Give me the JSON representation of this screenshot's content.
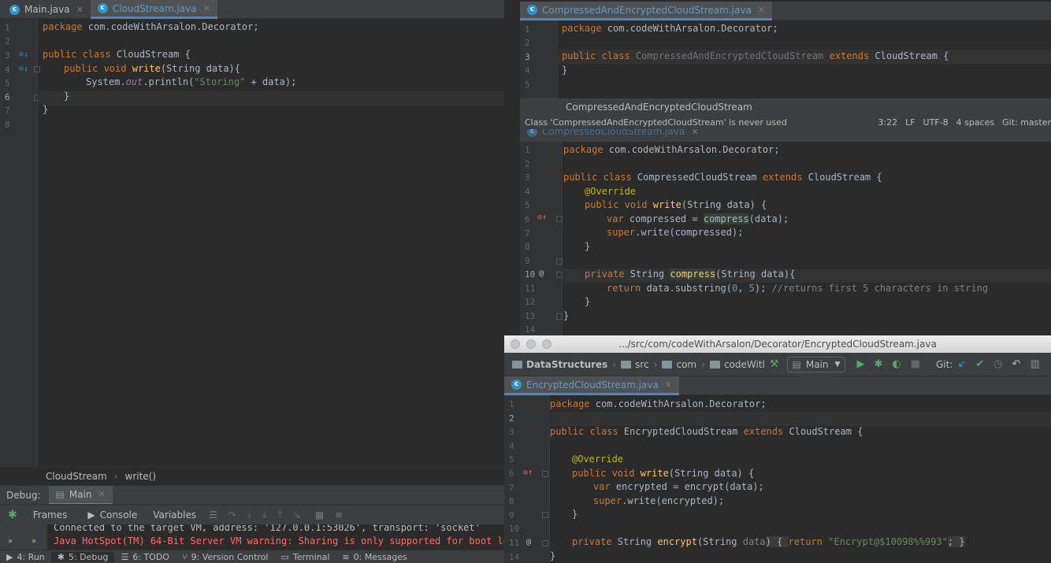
{
  "left_editor": {
    "tabs": [
      {
        "label": "Main.java",
        "icon": "c"
      },
      {
        "label": "CloudStream.java",
        "icon": "c"
      }
    ],
    "line_numbers": [
      "1",
      "2",
      "3",
      "4",
      "5",
      "6",
      "7",
      "8"
    ],
    "lines": [
      {
        "t1": "package",
        "t2": " com.codeWithArsalon.Decorator;"
      },
      {
        "t1": "public class",
        "t2": " CloudStream {"
      },
      {
        "t1": "public void",
        "t2": "write",
        "t3": "(String data){"
      },
      {
        "t1": "System.",
        "t2": "out",
        "t3": ".println(",
        "t4": "\"Storing\"",
        "t5": " + data);"
      },
      {
        "t1": "}"
      },
      {
        "t1": "}"
      }
    ],
    "breadcrumb": {
      "class": "CloudStream",
      "sep": "›",
      "method": "write()"
    }
  },
  "debug": {
    "label": "Debug:",
    "session": "Main",
    "tools": [
      "Frames",
      "Console",
      "Variables"
    ],
    "console_lines": [
      "Connected to the target VM, address: '127.0.0.1:53026', transport: 'socket'",
      "Java HotSpot(TM) 64-Bit Server VM warning: Sharing is only supported for boot loade"
    ]
  },
  "bottom_bar": {
    "items": [
      {
        "label": "4: Run",
        "icon": "▶"
      },
      {
        "label": "5: Debug",
        "icon": "✱"
      },
      {
        "label": "6: TODO",
        "icon": "☰"
      },
      {
        "label": "9: Version Control",
        "icon": "⑂"
      },
      {
        "label": "Terminal",
        "icon": "▭"
      },
      {
        "label": "0: Messages",
        "icon": "≡"
      }
    ]
  },
  "top_right_editor": {
    "tab": "CompressedAndEncryptedCloudStream.java",
    "line_numbers": [
      "1",
      "2",
      "3",
      "4",
      "5"
    ],
    "l1a": "package",
    "l1b": " com.codeWithArsalon.Decorator;",
    "l3a": "public class",
    "l3b": "CompressedAndEncryptedCloudStream",
    "l3c": "extends",
    "l3d": " CloudStream {",
    "l4": "}",
    "tooltip": "CompressedAndEncryptedCloudStream",
    "status_msg": "Class 'CompressedAndEncryptedCloudStream' is never used",
    "status_right": [
      "3:22",
      "LF",
      "UTF-8",
      "4 spaces",
      "Git: master"
    ]
  },
  "mid_right_editor": {
    "tab": "CompressedCloudStream.java",
    "line_numbers": [
      "1",
      "2",
      "3",
      "4",
      "5",
      "6",
      "7",
      "8",
      "9",
      "10",
      "11",
      "12",
      "13",
      "14"
    ],
    "l1a": "package",
    "l1b": " com.codeWithArsalon.Decorator;",
    "l3a": "public class",
    "l3b": " CompressedCloudStream ",
    "l3c": "extends",
    "l3d": " CloudStream {",
    "l4": "@Override",
    "l5a": "public void",
    "l5b": "write",
    "l5c": "(String data) {",
    "l6a": "var",
    "l6b": " compressed = ",
    "l6c": "compress",
    "l6d": "(data);",
    "l7a": "super",
    "l7b": ".write(compressed);",
    "l8": "}",
    "l10a": "private",
    "l10b": " String ",
    "l10c": "compress",
    "l10d": "(String data){",
    "l11a": "return",
    "l11b": " data.substring(",
    "l11c": "0",
    "l11d": ", ",
    "l11e": "5",
    "l11f": "); ",
    "l11g": "//returns first 5 characters in string",
    "l12": "}",
    "l13": "}"
  },
  "bottom_right_window": {
    "title": ".../src/com/codeWithArsalon/Decorator/EncryptedCloudStream.java",
    "nav": [
      "DataStructures",
      "src",
      "com",
      "codeWitl"
    ],
    "run_config": "Main",
    "git_label": "Git:",
    "tab": "EncryptedCloudStream.java",
    "line_numbers": [
      "1",
      "2",
      "3",
      "4",
      "5",
      "6",
      "7",
      "8",
      "9",
      "10",
      "11",
      "14"
    ],
    "l1a": "package",
    "l1b": " com.codeWithArsalon.Decorator;",
    "l3a": "public class",
    "l3b": " EncryptedCloudStream ",
    "l3c": "extends",
    "l3d": " CloudStream {",
    "l5": "@Override",
    "l6a": "public void",
    "l6b": "write",
    "l6c": "(String data) {",
    "l7a": "var",
    "l7b": " encrypted = ",
    "l7c": "encrypt",
    "l7d": "(data);",
    "l8a": "super",
    "l8b": ".write(encrypted);",
    "l9": "}",
    "l11a": "private",
    "l11b": " String ",
    "l11c": "encrypt",
    "l11d": "(String ",
    "l11e": "data",
    "l11f": ") { ",
    "l11g": "return",
    "l11h": "\"Encrypt@$10098%%993\"",
    "l11i": "; }",
    "l14": "}"
  }
}
